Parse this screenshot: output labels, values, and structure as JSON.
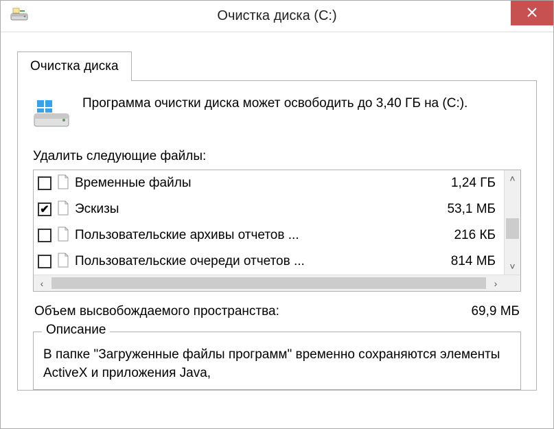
{
  "titlebar": {
    "title": "Очистка диска  (C:)"
  },
  "tab": {
    "label": "Очистка диска"
  },
  "intro": {
    "text": "Программа очистки диска может освободить до 3,40 ГБ на  (C:)."
  },
  "list": {
    "label": "Удалить следующие файлы:",
    "items": [
      {
        "checked": false,
        "name": "Временные файлы",
        "size": "1,24 ГБ"
      },
      {
        "checked": true,
        "name": "Эскизы",
        "size": "53,1 МБ"
      },
      {
        "checked": false,
        "name": "Пользовательские архивы отчетов ...",
        "size": "216 КБ"
      },
      {
        "checked": false,
        "name": "Пользовательские очереди отчетов ...",
        "size": "814 МБ"
      }
    ]
  },
  "total": {
    "label": "Объем высвобождаемого пространства:",
    "value": "69,9 МБ"
  },
  "description": {
    "title": "Описание",
    "text": "В папке \"Загруженные файлы программ\" временно сохраняются элементы ActiveX и приложения Java,"
  }
}
